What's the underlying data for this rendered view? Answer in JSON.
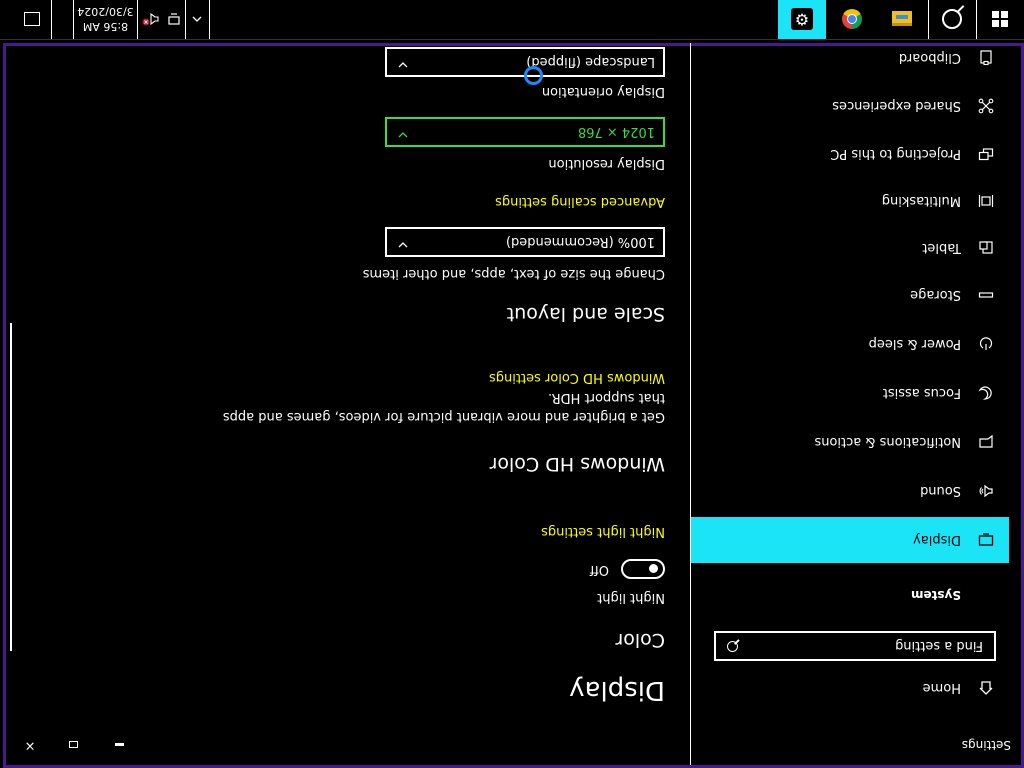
{
  "window": {
    "title": "Settings",
    "min_symbol": "",
    "max_symbol": "",
    "close_symbol": "×"
  },
  "sidebar": {
    "home": {
      "label": "Home",
      "icon": "home-icon"
    },
    "search": {
      "placeholder": "Find a setting",
      "icon": "search-icon"
    },
    "section": "System",
    "items": [
      {
        "label": "Display",
        "icon": "display-icon",
        "selected": true
      },
      {
        "label": "Sound",
        "icon": "speaker-icon",
        "selected": false
      },
      {
        "label": "Notifications & actions",
        "icon": "notification-icon",
        "selected": false
      },
      {
        "label": "Focus assist",
        "icon": "moon-icon",
        "selected": false
      },
      {
        "label": "Power & sleep",
        "icon": "power-icon",
        "selected": false
      },
      {
        "label": "Storage",
        "icon": "storage-icon",
        "selected": false
      },
      {
        "label": "Tablet",
        "icon": "tablet-icon",
        "selected": false
      },
      {
        "label": "Multitasking",
        "icon": "multitasking-icon",
        "selected": false
      },
      {
        "label": "Projecting to this PC",
        "icon": "projecting-icon",
        "selected": false
      },
      {
        "label": "Shared experiences",
        "icon": "shared-icon",
        "selected": false
      },
      {
        "label": "Clipboard",
        "icon": "clipboard-icon",
        "selected": false
      }
    ]
  },
  "main": {
    "title": "Display",
    "color": {
      "heading": "Color",
      "night_light_label": "Night light",
      "night_light_state": "Off",
      "night_light_link": "Night light settings"
    },
    "hd_color": {
      "heading": "Windows HD Color",
      "description": "Get a brighter and more vibrant picture for videos, games and apps that support HDR.",
      "link": "Windows HD Color settings"
    },
    "scale": {
      "heading": "Scale and layout",
      "size_label": "Change the size of text, apps, and other items",
      "size_value": "100% (Recommended)",
      "advanced_link": "Advanced scaling settings",
      "resolution_label": "Display resolution",
      "resolution_value": "1024 × 768",
      "orientation_label": "Display orientation",
      "orientation_value": "Landscape (flipped)"
    }
  },
  "taskbar": {
    "apps": [
      {
        "name": "File Explorer",
        "icon": "folder-icon",
        "active": false
      },
      {
        "name": "Google Chrome",
        "icon": "chrome-icon",
        "active": false
      },
      {
        "name": "Settings",
        "icon": "gear-icon",
        "active": true
      }
    ],
    "tray_chevron": "^",
    "clock_time": "8:56 AM",
    "clock_date": "3/30/2024"
  },
  "colors": {
    "accent": "#1ae4f5",
    "link": "#ffff00",
    "focus": "#3cdc3c",
    "window_border": "#4a1a8c"
  }
}
